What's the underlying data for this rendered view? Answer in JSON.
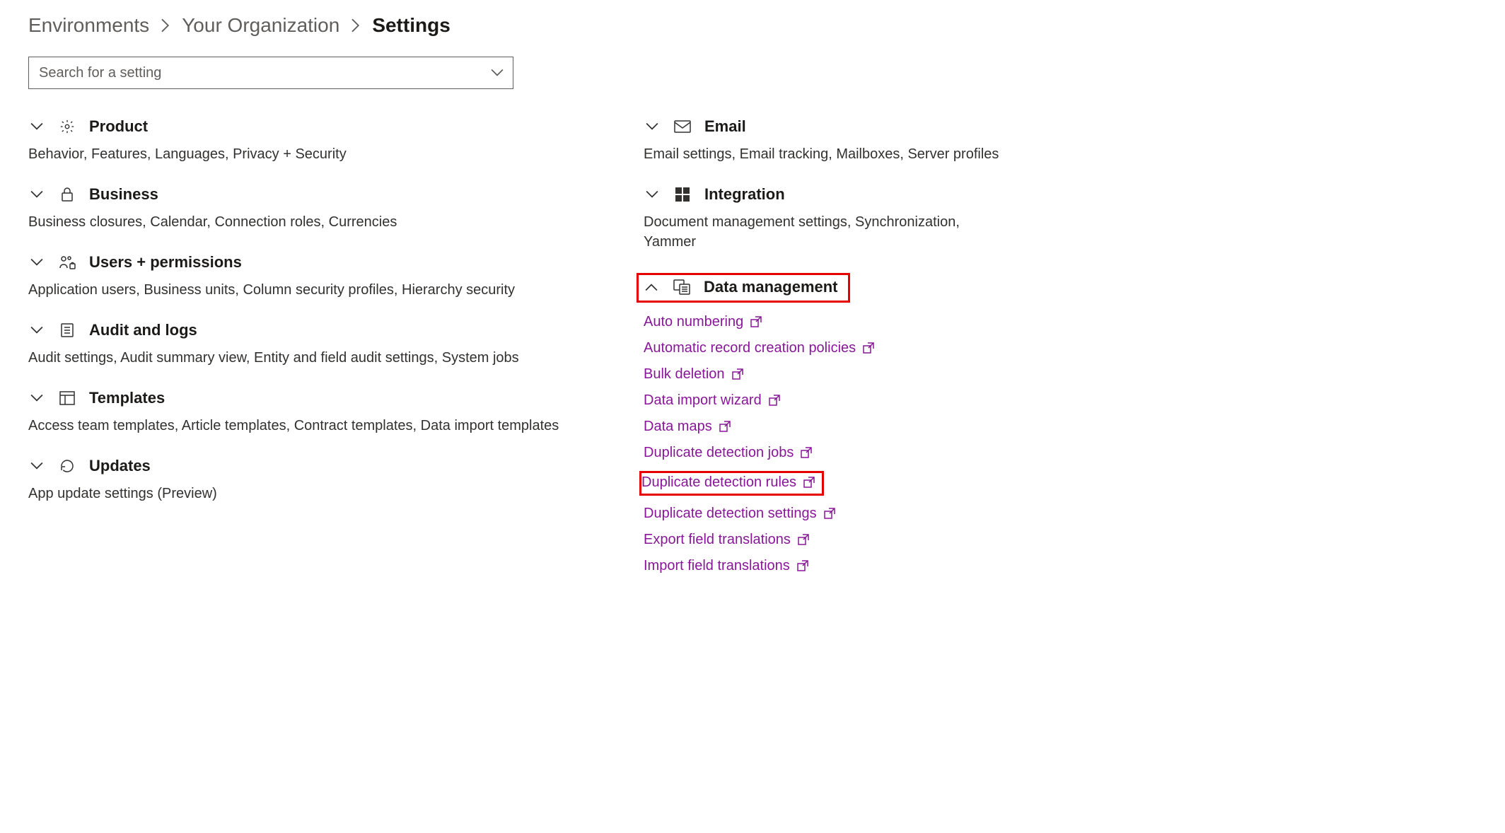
{
  "breadcrumb": {
    "items": [
      "Environments",
      "Your Organization",
      "Settings"
    ]
  },
  "search": {
    "placeholder": "Search for a setting"
  },
  "left_sections": [
    {
      "icon": "gear",
      "title": "Product",
      "desc": "Behavior, Features, Languages, Privacy + Security"
    },
    {
      "icon": "lock",
      "title": "Business",
      "desc": "Business closures, Calendar, Connection roles, Currencies"
    },
    {
      "icon": "people",
      "title": "Users + permissions",
      "desc": "Application users, Business units, Column security profiles, Hierarchy security"
    },
    {
      "icon": "list",
      "title": "Audit and logs",
      "desc": "Audit settings, Audit summary view, Entity and field audit settings, System jobs"
    },
    {
      "icon": "template",
      "title": "Templates",
      "desc": "Access team templates, Article templates, Contract templates, Data import templates"
    },
    {
      "icon": "refresh",
      "title": "Updates",
      "desc": "App update settings (Preview)"
    }
  ],
  "right_sections": {
    "email": {
      "title": "Email",
      "desc": "Email settings, Email tracking, Mailboxes, Server profiles"
    },
    "integration": {
      "title": "Integration",
      "desc": "Document management settings, Synchronization, Yammer"
    },
    "data_mgmt": {
      "title": "Data management",
      "links": [
        "Auto numbering",
        "Automatic record creation policies",
        "Bulk deletion",
        "Data import wizard",
        "Data maps",
        "Duplicate detection jobs",
        "Duplicate detection rules",
        "Duplicate detection settings",
        "Export field translations",
        "Import field translations"
      ]
    }
  }
}
